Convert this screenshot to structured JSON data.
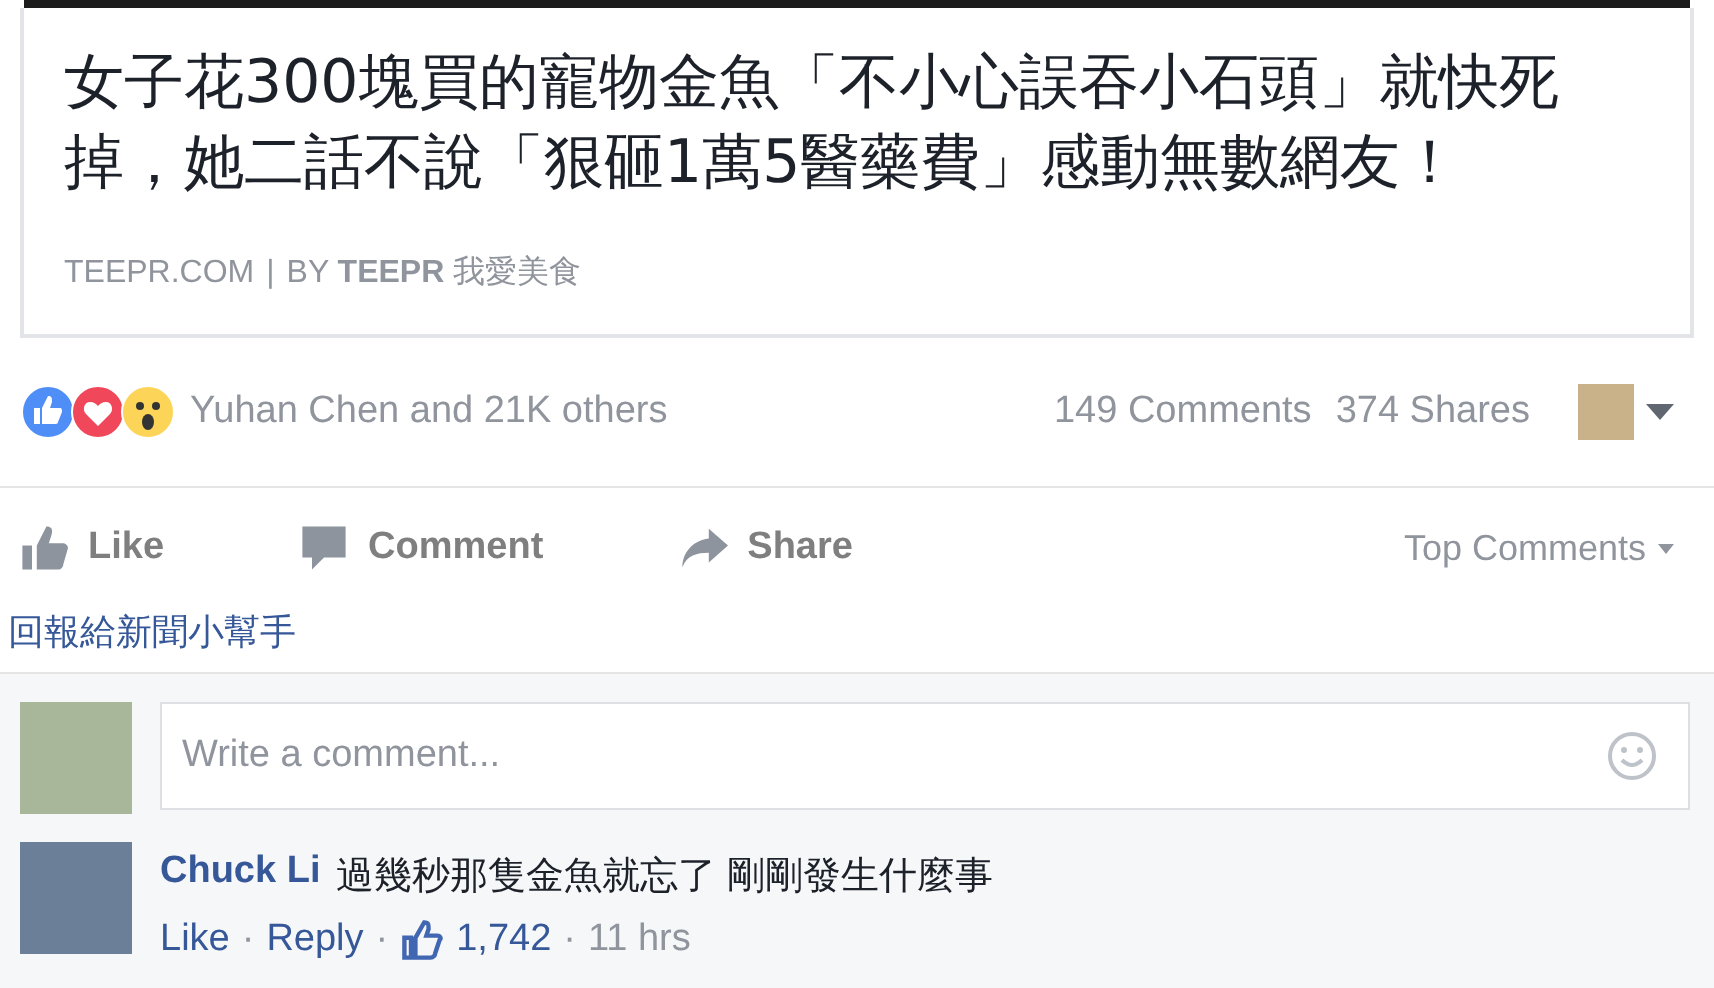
{
  "link_preview": {
    "title": "女子花300塊買的寵物金魚「不小心誤吞小石頭」就快死掉，她二話不說「狠砸1萬5醫藥費」感動無數網友！",
    "domain": "TEEPR.COM",
    "separator": "|",
    "by_label": "BY",
    "author": "TEEPR",
    "author_suffix": "我愛美食"
  },
  "reactions": {
    "summary": "Yuhan Chen and 21K others",
    "comments": "149 Comments",
    "shares": "374 Shares"
  },
  "actions": [
    "Like",
    "Comment",
    "Share"
  ],
  "sort": "Top Comments",
  "report_link": "回報給新聞小幫手",
  "comment_box": {
    "placeholder": "Write a comment..."
  },
  "comments": [
    {
      "author": "Chuck Li",
      "text": "過幾秒那隻金魚就忘了 剛剛發生什麼事",
      "like": "Like",
      "reply": "Reply",
      "likes": "1,742",
      "time": "11 hrs",
      "separator": "·"
    }
  ]
}
